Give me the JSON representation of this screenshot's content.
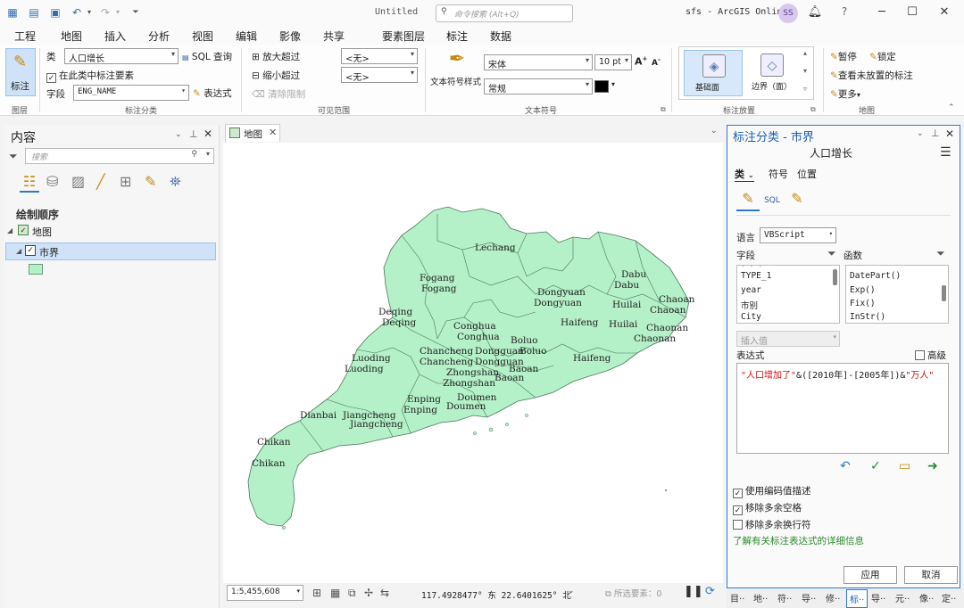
{
  "titlebar": {
    "doc_title": "Untitled",
    "search_placeholder": "命令搜索 (Alt+Q)",
    "user": "sfs - ArcGIS Online",
    "avatar": "SS",
    "bell_icon": "bell",
    "help": "?",
    "minimize": "─",
    "maximize": "☐",
    "close": "✕"
  },
  "menu_tabs": [
    "工程",
    "地图",
    "插入",
    "分析",
    "视图",
    "编辑",
    "影像",
    "共享",
    "要素图层",
    "标注",
    "数据"
  ],
  "active_tab": "标注",
  "ribbon": {
    "layer_group": {
      "button": "标注",
      "label": "图层"
    },
    "classes_group": {
      "class_label": "类",
      "class_value": "人口增长",
      "sql_query": "SQL 查询",
      "label_features_in_class": "在此类中标注要素",
      "field_label": "字段",
      "field_value": "ENG_NAME",
      "expression": "表达式",
      "label": "标注分类"
    },
    "visible_range_group": {
      "zoom_in_beyond": "放大超过",
      "zoom_out_beyond": "缩小超过",
      "clear_limits": "清除限制",
      "zoom_in_value": "<无>",
      "zoom_out_value": "<无>",
      "label": "可见范围"
    },
    "text_symbol_group": {
      "style_button": "文本符号样式",
      "font": "宋体",
      "size": "10 pt",
      "weight": "常规",
      "label": "文本符号"
    },
    "placement_group": {
      "basic_polygon": "基础面",
      "boundary_polygon": "边界（面）",
      "label": "标注放置"
    },
    "map_group": {
      "pause": "暂停",
      "lock": "锁定",
      "view_unplaced": "查看未放置的标注",
      "more": "更多",
      "label": "地图"
    }
  },
  "contents_pane": {
    "title": "内容",
    "search_placeholder": "搜索",
    "drawing_order": "绘制顺序",
    "map_node": "地图",
    "layer_node": "市界"
  },
  "map_view": {
    "tab": "地图",
    "scale": "1:5,455,608",
    "coords": "117.4928477° 东  22.6401625° 北",
    "selected_features": "所选要素：0",
    "cities": [
      {
        "name": "Lechang"
      },
      {
        "name": "Fogang"
      },
      {
        "name": "Fogang"
      },
      {
        "name": "Dongyuan"
      },
      {
        "name": "Dongyuan"
      },
      {
        "name": "Dabu"
      },
      {
        "name": "Dabu"
      },
      {
        "name": "Chaoan"
      },
      {
        "name": "Chaoan"
      },
      {
        "name": "Huilai"
      },
      {
        "name": "Huilai"
      },
      {
        "name": "Chaonan"
      },
      {
        "name": "Chaonan"
      },
      {
        "name": "Deqing"
      },
      {
        "name": "Deqing"
      },
      {
        "name": "Conghua"
      },
      {
        "name": "Conghua"
      },
      {
        "name": "Haifeng"
      },
      {
        "name": "Haifeng"
      },
      {
        "name": "Boluo"
      },
      {
        "name": "Boluo"
      },
      {
        "name": "Luoding"
      },
      {
        "name": "Luoding"
      },
      {
        "name": "Chancheng"
      },
      {
        "name": "Chancheng"
      },
      {
        "name": "Dongguan"
      },
      {
        "name": "Dongguan"
      },
      {
        "name": "Zhongshan"
      },
      {
        "name": "Zhongshan"
      },
      {
        "name": "Baoan"
      },
      {
        "name": "Baoan"
      },
      {
        "name": "Doumen"
      },
      {
        "name": "Doumen"
      },
      {
        "name": "Enping"
      },
      {
        "name": "Enping"
      },
      {
        "name": "Dianbai"
      },
      {
        "name": "Jiangcheng"
      },
      {
        "name": "Jiangcheng"
      },
      {
        "name": "Chikan"
      },
      {
        "name": "Chikan"
      }
    ]
  },
  "label_class_pane": {
    "title": "标注分类 - 市界",
    "class_name": "人口增长",
    "tabs": [
      "类",
      "符号",
      "位置"
    ],
    "language_label": "语言",
    "language_value": "VBScript",
    "fields_label": "字段",
    "functions_label": "函数",
    "fields": [
      "TYPE_1",
      "year",
      "市别",
      "City"
    ],
    "functions": [
      "DatePart()",
      "Exp()",
      "Fix()",
      "InStr()"
    ],
    "insert_values": "插入值",
    "expression_label": "表达式",
    "advanced_label": "高级",
    "expression_part1": "\"人口增加了\"",
    "expression_part2": "&([2010年]-[2005年])&",
    "expression_part3": "\"万人\"",
    "opt_coded_values": "使用编码值描述",
    "opt_remove_spaces": "移除多余空格",
    "opt_remove_newlines": "移除多余换行符",
    "learn_more": "了解有关标注表达式的详细信息",
    "apply": "应用",
    "cancel": "取消"
  },
  "bottom_tabs": [
    "目··",
    "地··",
    "符··",
    "导··",
    "修··",
    "标··",
    "导··",
    "元··",
    "像··",
    "定··"
  ],
  "colors": {
    "map_fill": "#b4f0c8",
    "accent": "#2a7ad0",
    "expression_red": "#d01010",
    "link_green": "#2a8a2a"
  }
}
